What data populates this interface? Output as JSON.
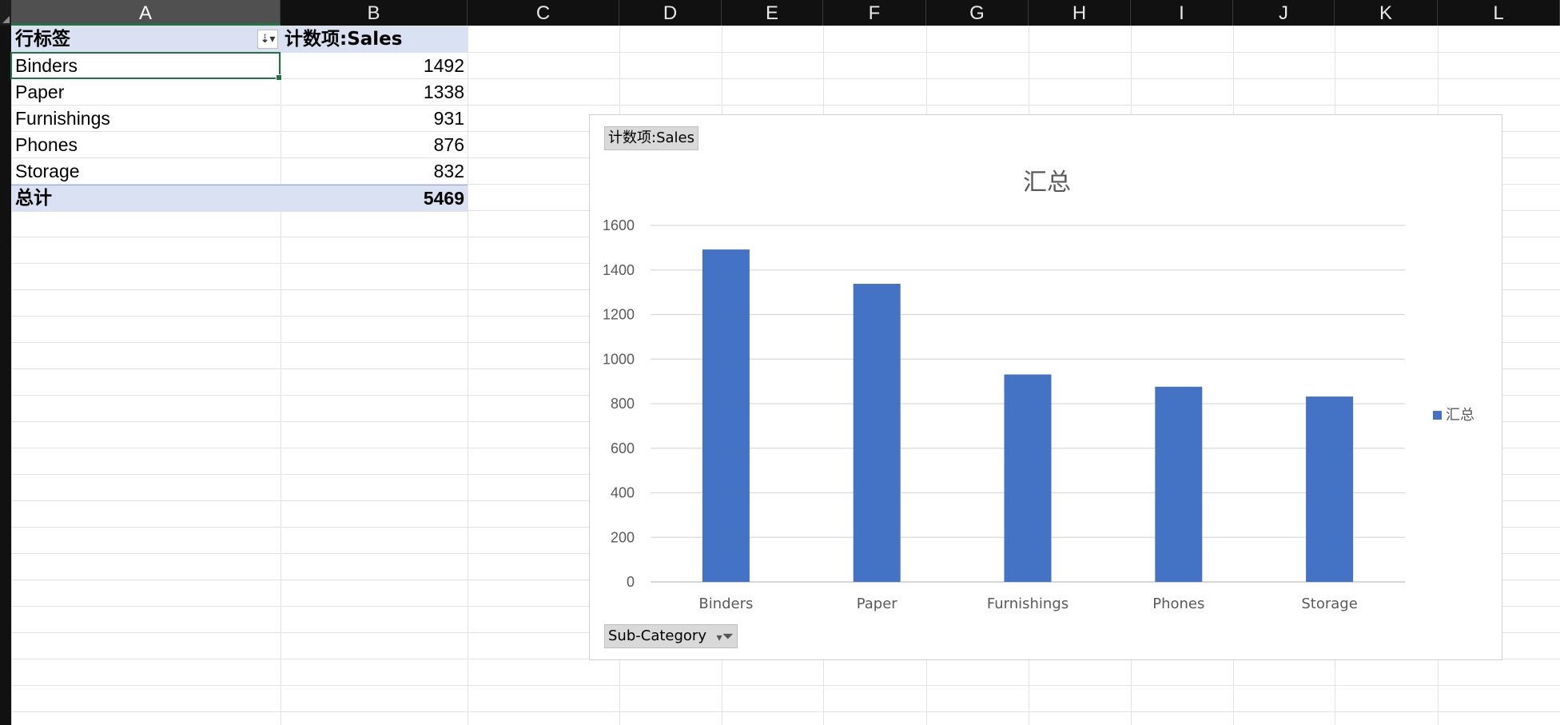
{
  "sheet": {
    "columns": [
      "A",
      "B",
      "C",
      "D",
      "E",
      "F",
      "G",
      "H",
      "I",
      "J",
      "K",
      "L"
    ],
    "selected_column": "A"
  },
  "pivot": {
    "row_label_header": "行标签",
    "value_header": "计数项:Sales",
    "rows": [
      {
        "label": "Binders",
        "value": "1492"
      },
      {
        "label": "Paper",
        "value": "1338"
      },
      {
        "label": "Furnishings",
        "value": "931"
      },
      {
        "label": "Phones",
        "value": "876"
      },
      {
        "label": "Storage",
        "value": "832"
      }
    ],
    "total_label": "总计",
    "total_value": "5469"
  },
  "chart_data": {
    "type": "bar",
    "title": "汇总",
    "categories": [
      "Binders",
      "Paper",
      "Furnishings",
      "Phones",
      "Storage"
    ],
    "series": [
      {
        "name": "汇总",
        "values": [
          1492,
          1338,
          931,
          876,
          832
        ]
      }
    ],
    "ylim": [
      0,
      1600
    ],
    "yticks": [
      0,
      200,
      400,
      600,
      800,
      1000,
      1200,
      1400,
      1600
    ],
    "grid": true,
    "legend": "right",
    "bar_color": "#4472c4",
    "value_field_button": "计数项:Sales",
    "axis_field_button": "Sub-Category"
  },
  "icons": {
    "pivot_filter": "filter-sort-icon",
    "chart_filter": "funnel-icon"
  }
}
